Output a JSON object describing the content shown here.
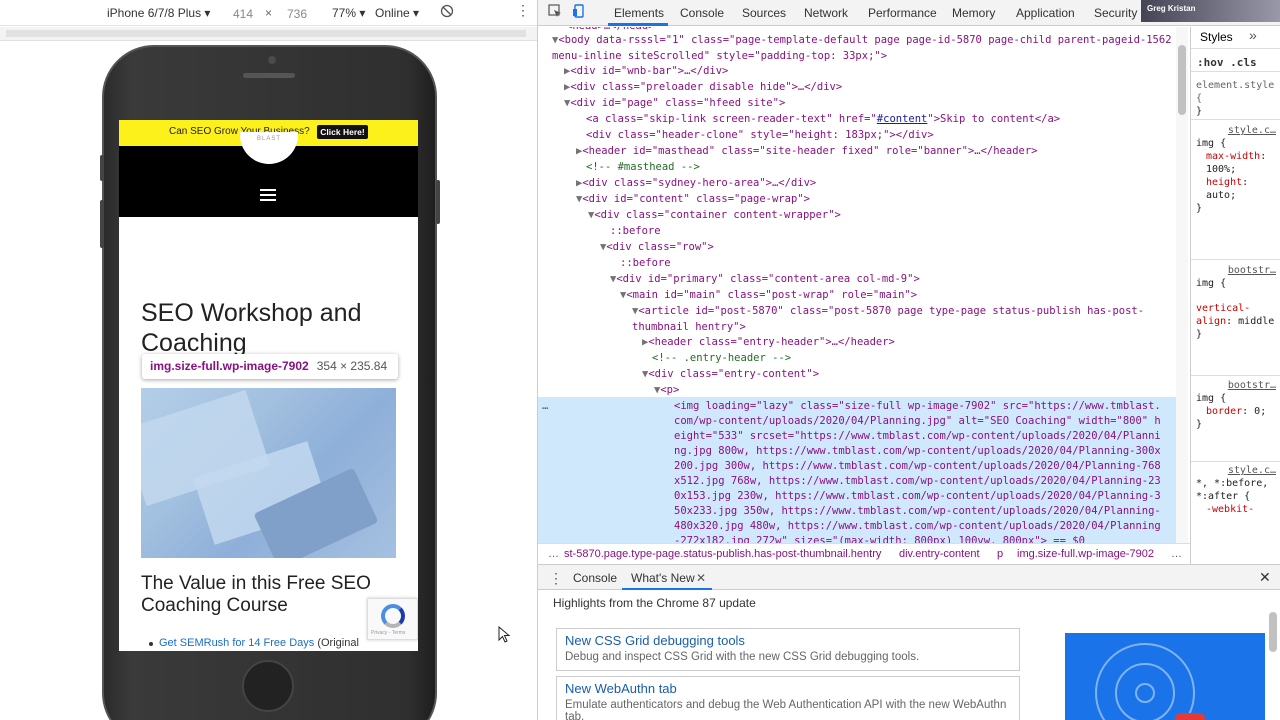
{
  "device_toolbar": {
    "device": "iPhone 6/7/8 Plus",
    "width": "414",
    "times": "×",
    "height": "736",
    "zoom": "77%",
    "network": "Online"
  },
  "site": {
    "promo_text": "Can SEO Grow Your Business?",
    "promo_button": "Click Here!",
    "logo_text": "BLAST",
    "page_title": "SEO Workshop and Coaching",
    "value_heading": "The Value in this Free SEO Coaching Course",
    "bullet_link": "Get SEMRush for 14 Free Days",
    "bullet_rest": " (Original",
    "recaptcha_text": "Privacy - Terms"
  },
  "tooltip": {
    "selector": "img.size-full.wp-image-7902",
    "dims": "354 × 235.84"
  },
  "devtools_tabs": [
    "Elements",
    "Console",
    "Sources",
    "Network",
    "Performance",
    "Memory",
    "Application",
    "Security"
  ],
  "user_badge": "Greg Kristan",
  "elements": {
    "l0": "<head>…</head>",
    "body_open": "<body data-rsssl=\"1\" class=\"page-template-default page page-id-5870 page-child parent-pageid-1562 menu-inline siteScrolled\" style=\"padding-top: 33px;\">",
    "l1": "<div id=\"wnb-bar\">…</div>",
    "l2": "<div class=\"preloader disable hide\">…</div>",
    "l3": "<div id=\"page\" class=\"hfeed site\">",
    "l4a": "<a class=\"skip-link screen-reader-text\" href=\"",
    "l4link": "#content",
    "l4b": "\">Skip to content</a>",
    "l5": "<div class=\"header-clone\" style=\"height: 183px;\"></div>",
    "l6": "<header id=\"masthead\" class=\"site-header fixed\" role=\"banner\">…</header>",
    "l7": "<!-- #masthead -->",
    "l8": "<div class=\"sydney-hero-area\">…</div>",
    "l9": "<div id=\"content\" class=\"page-wrap\">",
    "l10": "<div class=\"container content-wrapper\">",
    "l11": "::before",
    "l12": "<div class=\"row\">",
    "l13": "::before",
    "l14": "<div id=\"primary\" class=\"content-area col-md-9\">",
    "l15": "<main id=\"main\" class=\"post-wrap\" role=\"main\">",
    "l16": "<article id=\"post-5870\" class=\"post-5870 page type-page status-publish has-post-thumbnail hentry\">",
    "l17": "<header class=\"entry-header\">…</header>",
    "l18": "<!-- .entry-header -->",
    "l19": "<div class=\"entry-content\">",
    "l20": "<p>",
    "img_line": "<img loading=\"lazy\" class=\"size-full wp-image-7902\" src=\"https://www.tmblast.com/wp-content/uploads/2020/04/Planning.jpg\" alt=\"SEO Coaching\" width=\"800\" height=\"533\" srcset=\"https://www.tmblast.com/wp-content/uploads/2020/04/Planning.jpg 800w, https://www.tmblast.com/wp-content/uploads/2020/04/Planning-300x200.jpg 300w, https://www.tmblast.com/wp-content/uploads/2020/04/Planning-768x512.jpg 768w, https://www.tmblast.com/wp-content/uploads/2020/04/Planning-230x153.jpg 230w, https://www.tmblast.com/wp-content/uploads/2020/04/Planning-350x233.jpg 350w, https://www.tmblast.com/wp-content/uploads/2020/04/Planning-480x320.jpg 480w, https://www.tmblast.com/wp-content/uploads/2020/04/Planning-272x182.jpg 272w\" sizes=\"(max-width: 800px) 100vw, 800px\"> == $0",
    "ellipsis": "…"
  },
  "breadcrumbs": {
    "ellipsis": "…",
    "b1": "st-5870.page.type-page.status-publish.has-post-thumbnail.hentry",
    "b2": "div.entry-content",
    "b3": "p",
    "b4": "img.size-full.wp-image-7902",
    "more": "…"
  },
  "styles": {
    "tab": "Styles",
    "chevron": "»",
    "filter": ":hov .cls",
    "element_style": "element.style {",
    "close": "}",
    "src1": "style.c…",
    "sel_img": "img {",
    "p_maxw": "max-width",
    "v_maxw": "100%;",
    "p_h": "height",
    "v_h": "auto;",
    "src2": "bootstr…",
    "p_va": "vertical-align",
    "v_va": "middle",
    "src3": "bootstr…",
    "p_border": "border",
    "v_border": "0;",
    "src4": "style.c…",
    "sel_star": "*, *:before, *:after {",
    "p_webkit": "-webkit-"
  },
  "drawer": {
    "tabs": [
      "Console",
      "What's New"
    ],
    "highlights": "Highlights from the Chrome 87 update",
    "cards": [
      {
        "title": "New CSS Grid debugging tools",
        "desc": "Debug and inspect CSS Grid with the new CSS Grid debugging tools."
      },
      {
        "title": "New WebAuthn tab",
        "desc": "Emulate authenticators and debug the Web Authentication API with the new WebAuthn tab."
      }
    ]
  },
  "colors": {
    "promo_yellow": "#fdf11c",
    "devtools_blue": "#1a73e8",
    "selection_blue": "#cfe8fc",
    "tag_purple": "#881280"
  }
}
